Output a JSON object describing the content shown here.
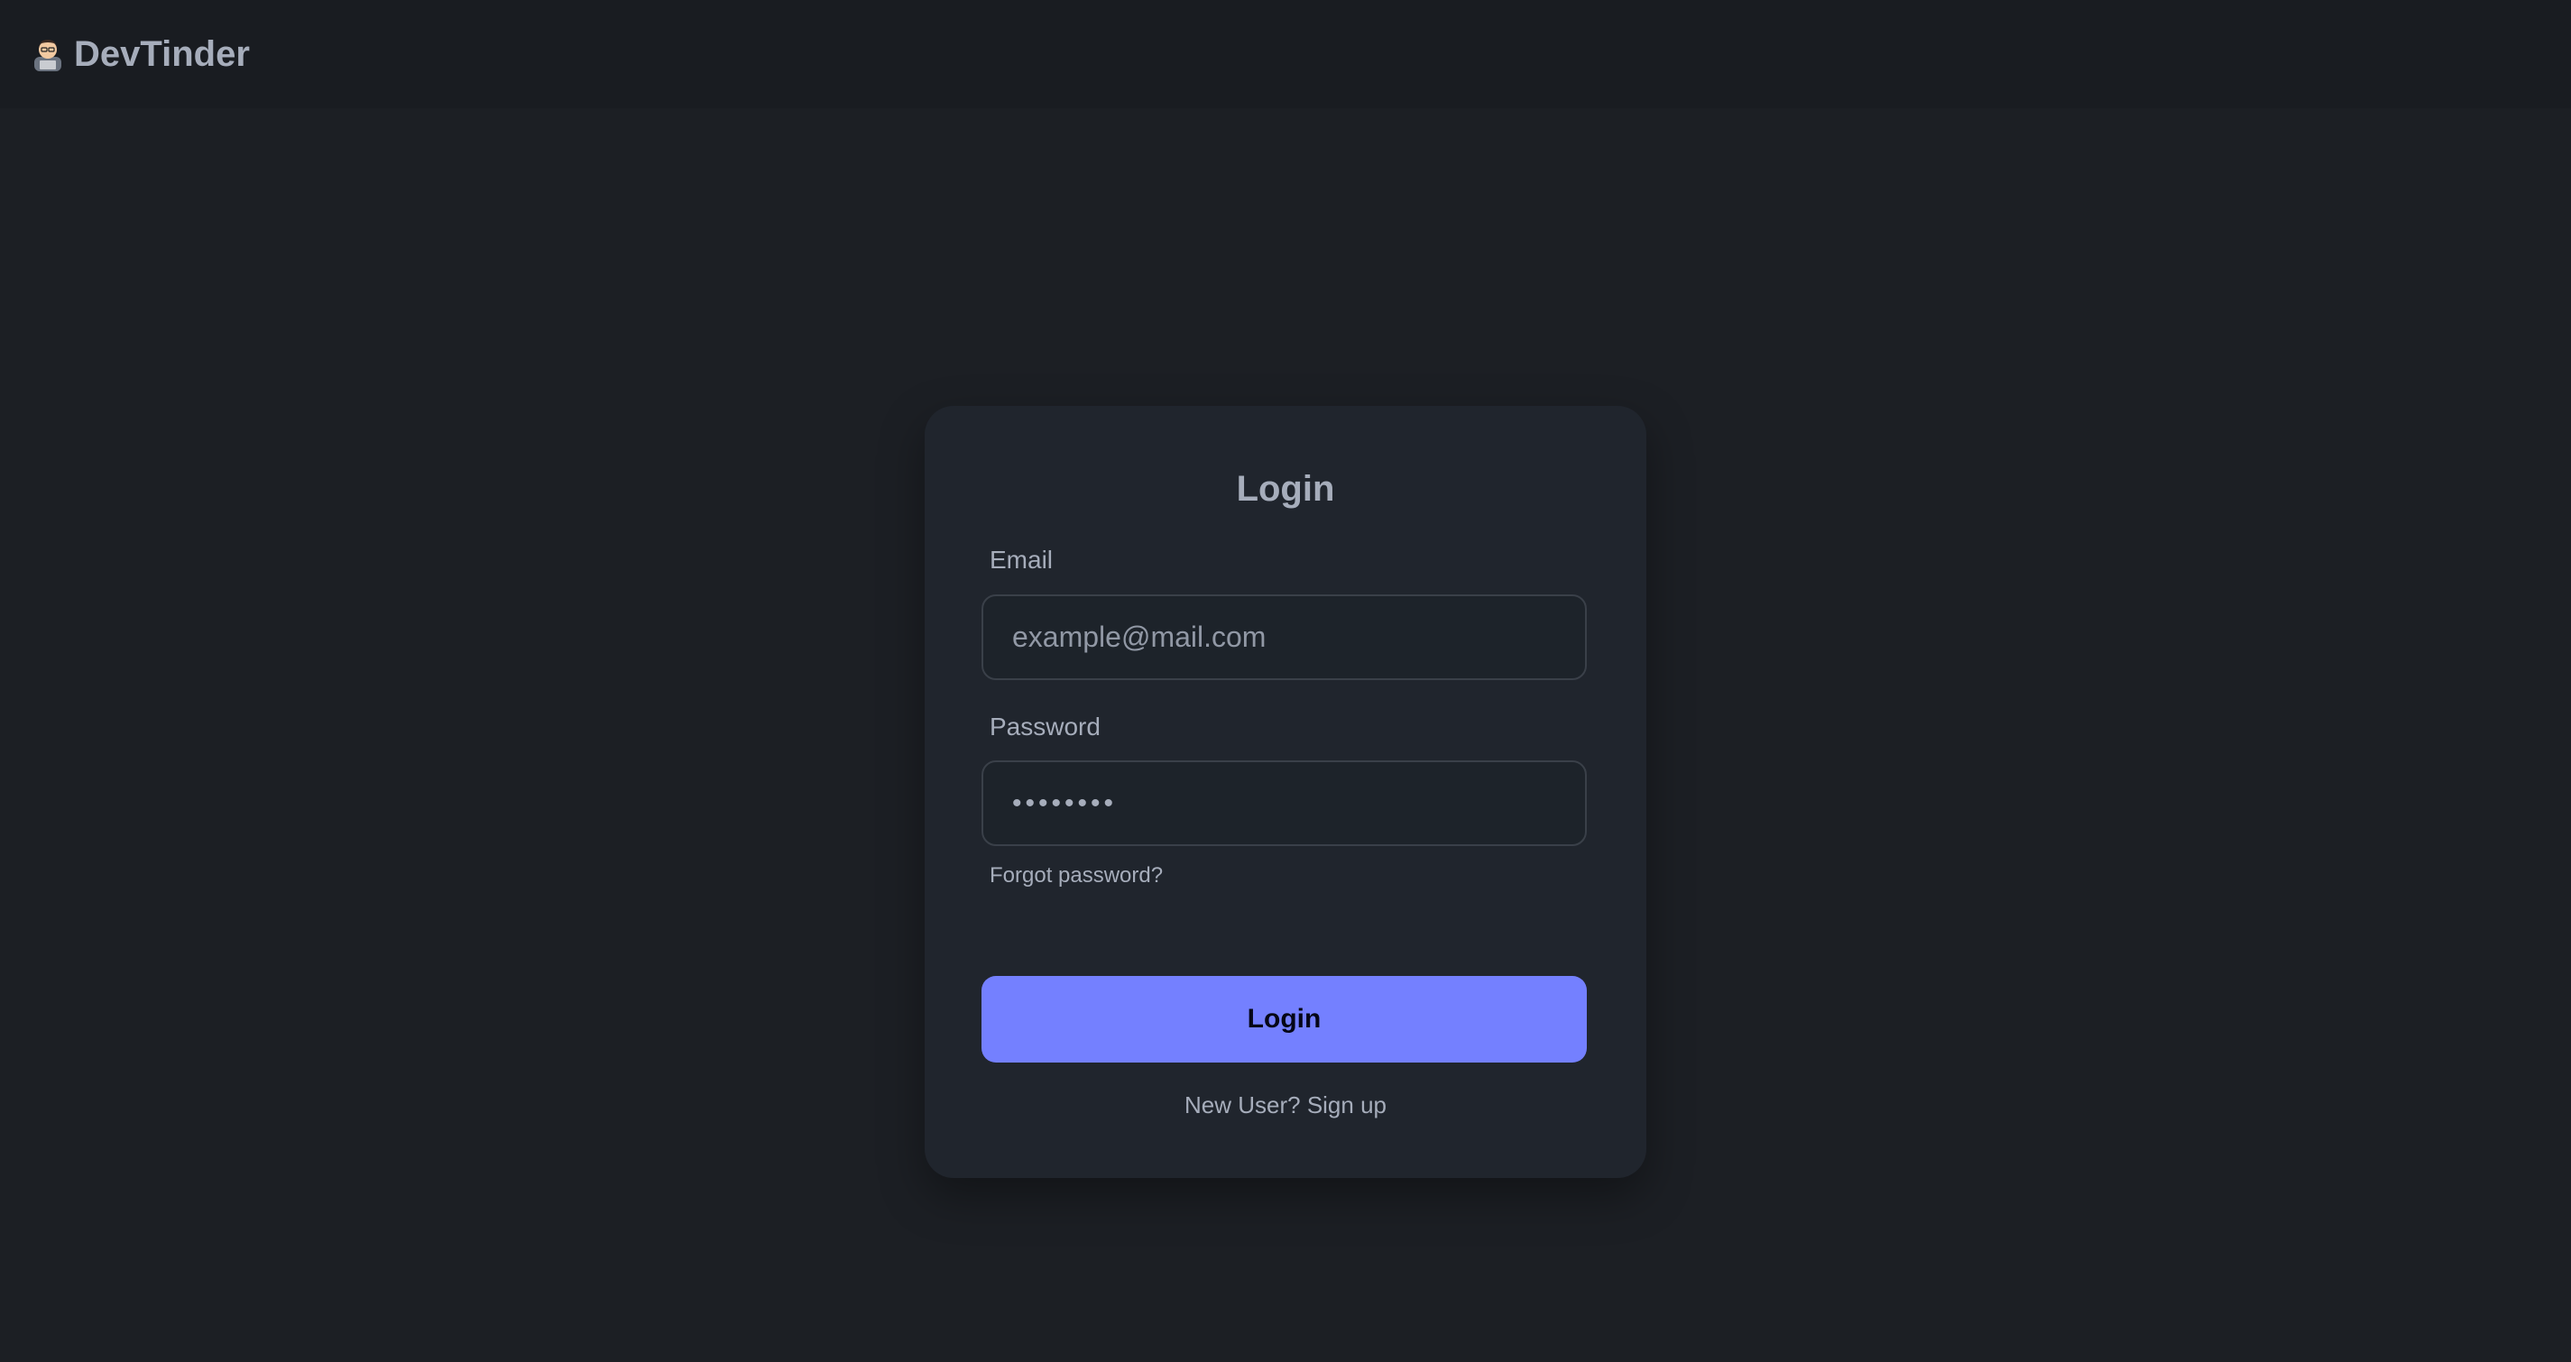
{
  "navbar": {
    "brand_name": "DevTinder",
    "brand_icon": "developer-avatar-icon"
  },
  "login_card": {
    "title": "Login",
    "email": {
      "label": "Email",
      "placeholder": "example@mail.com",
      "value": ""
    },
    "password": {
      "label": "Password",
      "value": "••••••••"
    },
    "forgot_password_label": "Forgot password?",
    "submit_label": "Login",
    "signup_text": "New User? Sign up"
  },
  "colors": {
    "background": "#1c1f24",
    "navbar": "#191c21",
    "card": "#20252d",
    "text": "#a6adbb",
    "primary": "#7480ff"
  }
}
